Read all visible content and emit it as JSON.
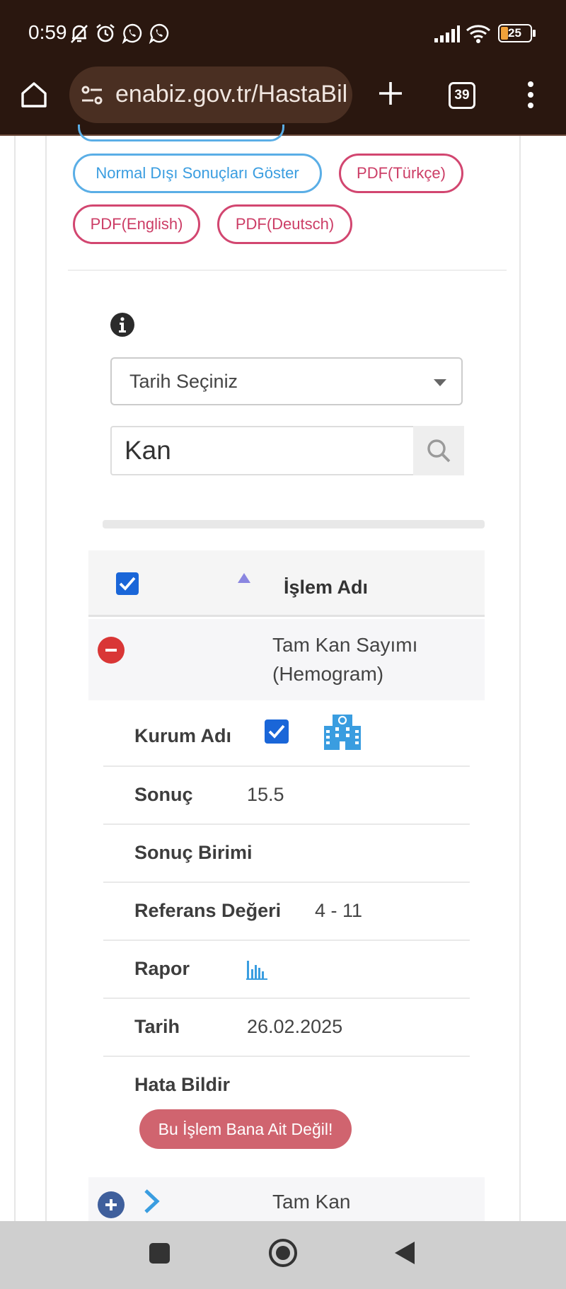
{
  "status_bar": {
    "time": "0:59",
    "battery": "25",
    "icons": [
      "bell-off-icon",
      "alarm-icon",
      "whatsapp-icon",
      "whatsapp-icon",
      "signal-icon",
      "wifi-icon",
      "battery-icon"
    ]
  },
  "browser": {
    "url": "enabiz.gov.tr/HastaBil",
    "tab_count": "39",
    "icons": [
      "home-icon",
      "site-settings-icon",
      "new-tab-icon",
      "tabs-icon",
      "menu-icon"
    ]
  },
  "actions": {
    "abnormal_label": "Normal Dışı Sonuçları Göster",
    "pdf_tr_label": "PDF(Türkçe)",
    "pdf_en_label": "PDF(English)",
    "pdf_de_label": "PDF(Deutsch)"
  },
  "filters": {
    "date_select_value": "Tarih Seçiniz",
    "search_value": "Kan"
  },
  "table": {
    "header_label": "İşlem Adı",
    "row1": {
      "name_line1": "Tam Kan Sayımı",
      "name_line2": "(Hemogram)",
      "details": {
        "kurum_label": "Kurum Adı",
        "sonuc_label": "Sonuç",
        "sonuc_value": "15.5",
        "birim_label": "Sonuç Birimi",
        "referans_label": "Referans Değeri",
        "referans_value": "4 - 11",
        "rapor_label": "Rapor",
        "tarih_label": "Tarih",
        "tarih_value": "26.02.2025",
        "hata_label": "Hata Bildir",
        "report_button_label": "Bu İşlem Bana Ait Değil!"
      }
    },
    "row2": {
      "name_line1": "Tam Kan"
    }
  },
  "colors": {
    "status_bg": "#2a170f",
    "accent_blue": "#3a9de0",
    "accent_red": "#cc3d66",
    "danger_button": "#d0646f",
    "expand_blue": "#3f5f9c"
  }
}
